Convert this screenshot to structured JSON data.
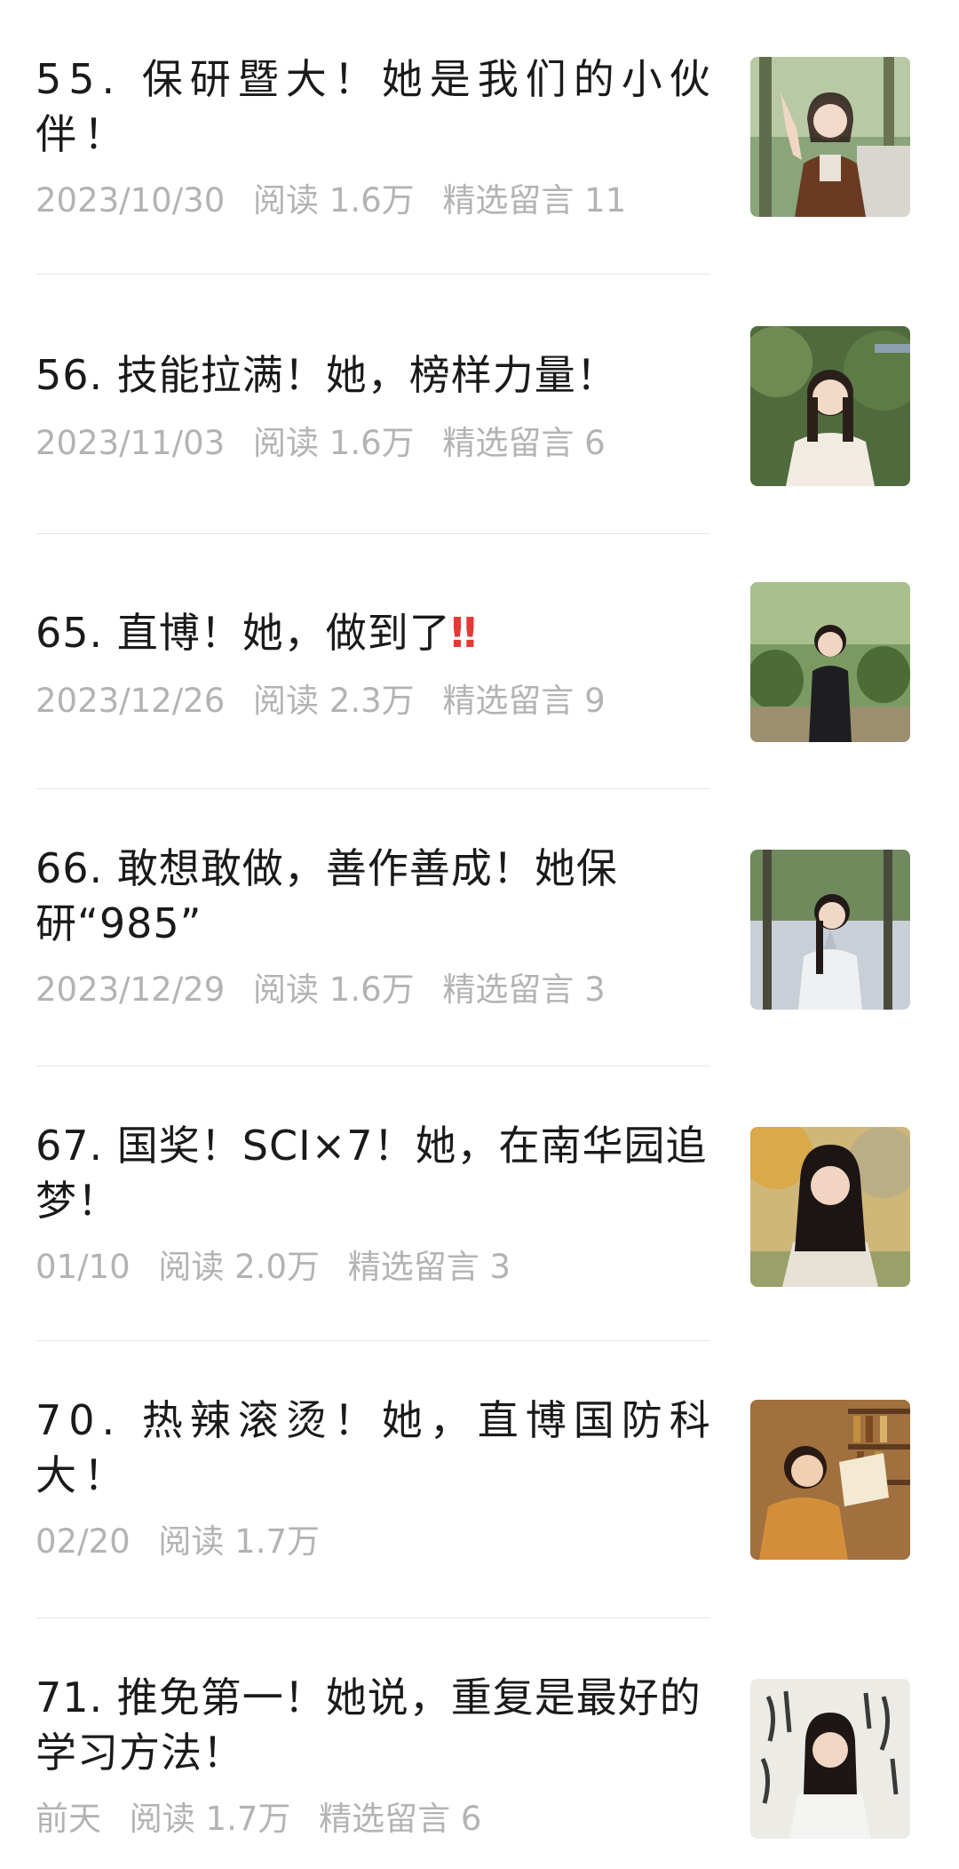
{
  "articles": [
    {
      "title": "55. 保研暨大！她是我们的小伙伴！",
      "date": "2023/10/30",
      "reads": "阅读 1.6万",
      "comments": "精选留言 11",
      "thumb": "photo-girl-peace-sign"
    },
    {
      "title": "56. 技能拉满！她，榜样力量！",
      "date": "2023/11/03",
      "reads": "阅读 1.6万",
      "comments": "精选留言 6",
      "thumb": "photo-girl-garden"
    },
    {
      "title": "65. 直博！她，做到了",
      "title_suffix": "‼",
      "date": "2023/12/26",
      "reads": "阅读 2.3万",
      "comments": "精选留言 9",
      "thumb": "photo-girl-hedges"
    },
    {
      "title": "66. 敢想敢做，善作善成！她保研“985”",
      "date": "2023/12/29",
      "reads": "阅读 1.6万",
      "comments": "精选留言 3",
      "thumb": "photo-girl-tree-road"
    },
    {
      "title": "67. 国奖！SCI×7！她，在南华园追梦！",
      "date": "01/10",
      "reads": "阅读 2.0万",
      "comments": "精选留言 3",
      "thumb": "photo-girl-autumn"
    },
    {
      "title": "70. 热辣滚烫！她，直博国防科大！",
      "date": "02/20",
      "reads": "阅读 1.7万",
      "comments": "",
      "thumb": "photo-girl-library"
    },
    {
      "title": "71. 推免第一！她说，重复是最好的学习方法！",
      "date": "前天",
      "reads": "阅读 1.7万",
      "comments": "精选留言 6",
      "thumb": "photo-girl-calligraphy"
    }
  ]
}
